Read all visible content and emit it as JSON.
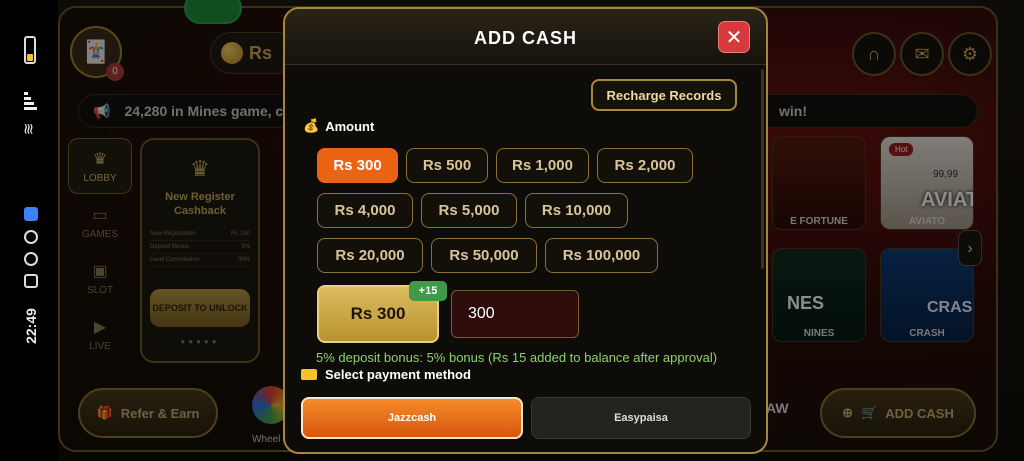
{
  "status": {
    "time": "22:49"
  },
  "header": {
    "balance_prefix": "Rs"
  },
  "ticker": {
    "text_left": "24,280 in Mines game, co",
    "text_right": "win!"
  },
  "side_nav": [
    {
      "label": "LOBBY",
      "icon": "crown-icon"
    },
    {
      "label": "GAMES",
      "icon": "cards-icon"
    },
    {
      "label": "SLOT",
      "icon": "slot-icon"
    },
    {
      "label": "LIVE",
      "icon": "play-icon"
    }
  ],
  "promo": {
    "title": "New Register Cashback",
    "rows": [
      {
        "k": "New Registration",
        "v": "Rs 150"
      },
      {
        "k": "Deposit Bonus",
        "v": "5%"
      },
      {
        "k": "Level Commission",
        "v": "30%"
      }
    ],
    "button": "DEPOSIT TO UNLOCK"
  },
  "tiles": [
    {
      "label": "E FORTUNE",
      "badge": ""
    },
    {
      "label": "AVIATO",
      "badge": "Hot",
      "overlay": "AVIAT",
      "sub": "99,99"
    },
    {
      "label": "NINES",
      "overlay": "NES"
    },
    {
      "label": "CRASH",
      "overlay": "CRAS"
    }
  ],
  "bottom": {
    "refer": "Refer & Earn",
    "wheel": "Wheel",
    "withdraw_partial": "AW",
    "add_cash": "ADD CASH"
  },
  "modal": {
    "title": "ADD CASH",
    "recharge_records": "Recharge Records",
    "amount_label": "Amount",
    "amounts": [
      "Rs 300",
      "Rs 500",
      "Rs 1,000",
      "Rs 2,000",
      "Rs 4,000",
      "Rs 5,000",
      "Rs 10,000",
      "Rs 20,000",
      "Rs 50,000",
      "Rs 100,000"
    ],
    "selected_amount": "Rs 300",
    "bonus_tag": "+15",
    "input_value": "300",
    "bonus_note": "5% deposit bonus: 5% bonus (Rs 15 added to balance after approval)",
    "payment_label": "Select payment method",
    "payments": [
      "Jazzcash",
      "Easypaisa"
    ],
    "active_payment": "Jazzcash"
  },
  "colors": {
    "accent_orange": "#ea6413",
    "gold": "#a7873a",
    "close_red": "#d73a3a",
    "bonus_green": "#8fd06e"
  }
}
